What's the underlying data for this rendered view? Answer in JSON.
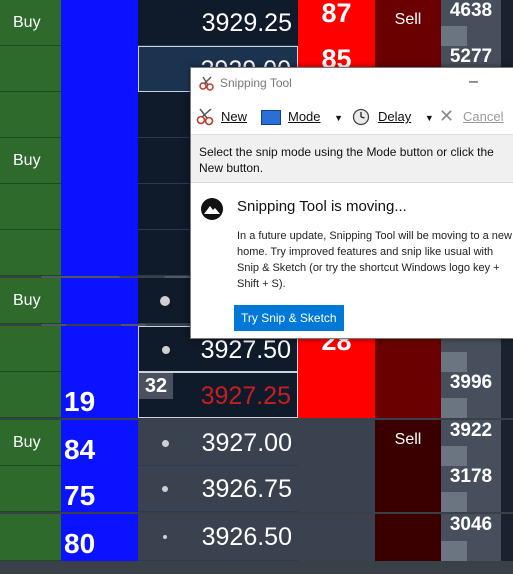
{
  "ladder": {
    "rows": [
      {
        "buy": "Buy",
        "bid_qty": "",
        "price": "3929.25",
        "ask_qty": "87",
        "sell": "Sell",
        "vol": "4638"
      },
      {
        "buy": "",
        "bid_qty": "",
        "price": "3929.00",
        "ask_qty": "85",
        "sell": "",
        "vol": "5277"
      },
      {
        "buy": "",
        "bid_qty": "",
        "price": "",
        "ask_qty": "",
        "sell": "",
        "vol": ""
      },
      {
        "buy": "Buy",
        "bid_qty": "",
        "price": "",
        "ask_qty": "",
        "sell": "",
        "vol": ""
      },
      {
        "buy": "",
        "bid_qty": "",
        "price": "",
        "ask_qty": "",
        "sell": "",
        "vol": ""
      },
      {
        "buy": "",
        "bid_qty": "",
        "price": "",
        "ask_qty": "",
        "sell": "",
        "vol": ""
      },
      {
        "buy": "Buy",
        "bid_qty": "",
        "price": "",
        "ask_qty": "",
        "sell": "",
        "vol": ""
      },
      {
        "buy": "",
        "bid_qty": "",
        "price": "3927.50",
        "ask_qty": "28",
        "sell": "",
        "vol": ""
      },
      {
        "buy": "",
        "bid_qty": "19",
        "price": "3927.25",
        "ask_qty": "",
        "sell": "",
        "vol": "3996",
        "badge": "32"
      },
      {
        "buy": "Buy",
        "bid_qty": "84",
        "price": "3927.00",
        "ask_qty": "",
        "sell": "Sell",
        "vol": "3922"
      },
      {
        "buy": "",
        "bid_qty": "75",
        "price": "3926.75",
        "ask_qty": "",
        "sell": "",
        "vol": "3178"
      },
      {
        "buy": "",
        "bid_qty": "80",
        "price": "3926.50",
        "ask_qty": "",
        "sell": "",
        "vol": "3046"
      }
    ],
    "colors": {
      "buy": "#2d6a2c",
      "bid": "#0a12ff",
      "ask": "#ff0000",
      "sell": "#6b0000",
      "last_price": "#c81e1e"
    }
  },
  "snip": {
    "title": "Snipping Tool",
    "toolbar": {
      "new": "New",
      "mode": "Mode",
      "delay": "Delay",
      "cancel": "Cancel"
    },
    "instruction": "Select the snip mode using the Mode button or click the New button.",
    "moving_title": "Snipping Tool is moving...",
    "moving_body": "In a future update, Snipping Tool will be moving to a new home. Try improved features and snip like usual with Snip & Sketch (or try the shortcut Windows logo key + Shift + S).",
    "try_button": "Try Snip & Sketch"
  }
}
